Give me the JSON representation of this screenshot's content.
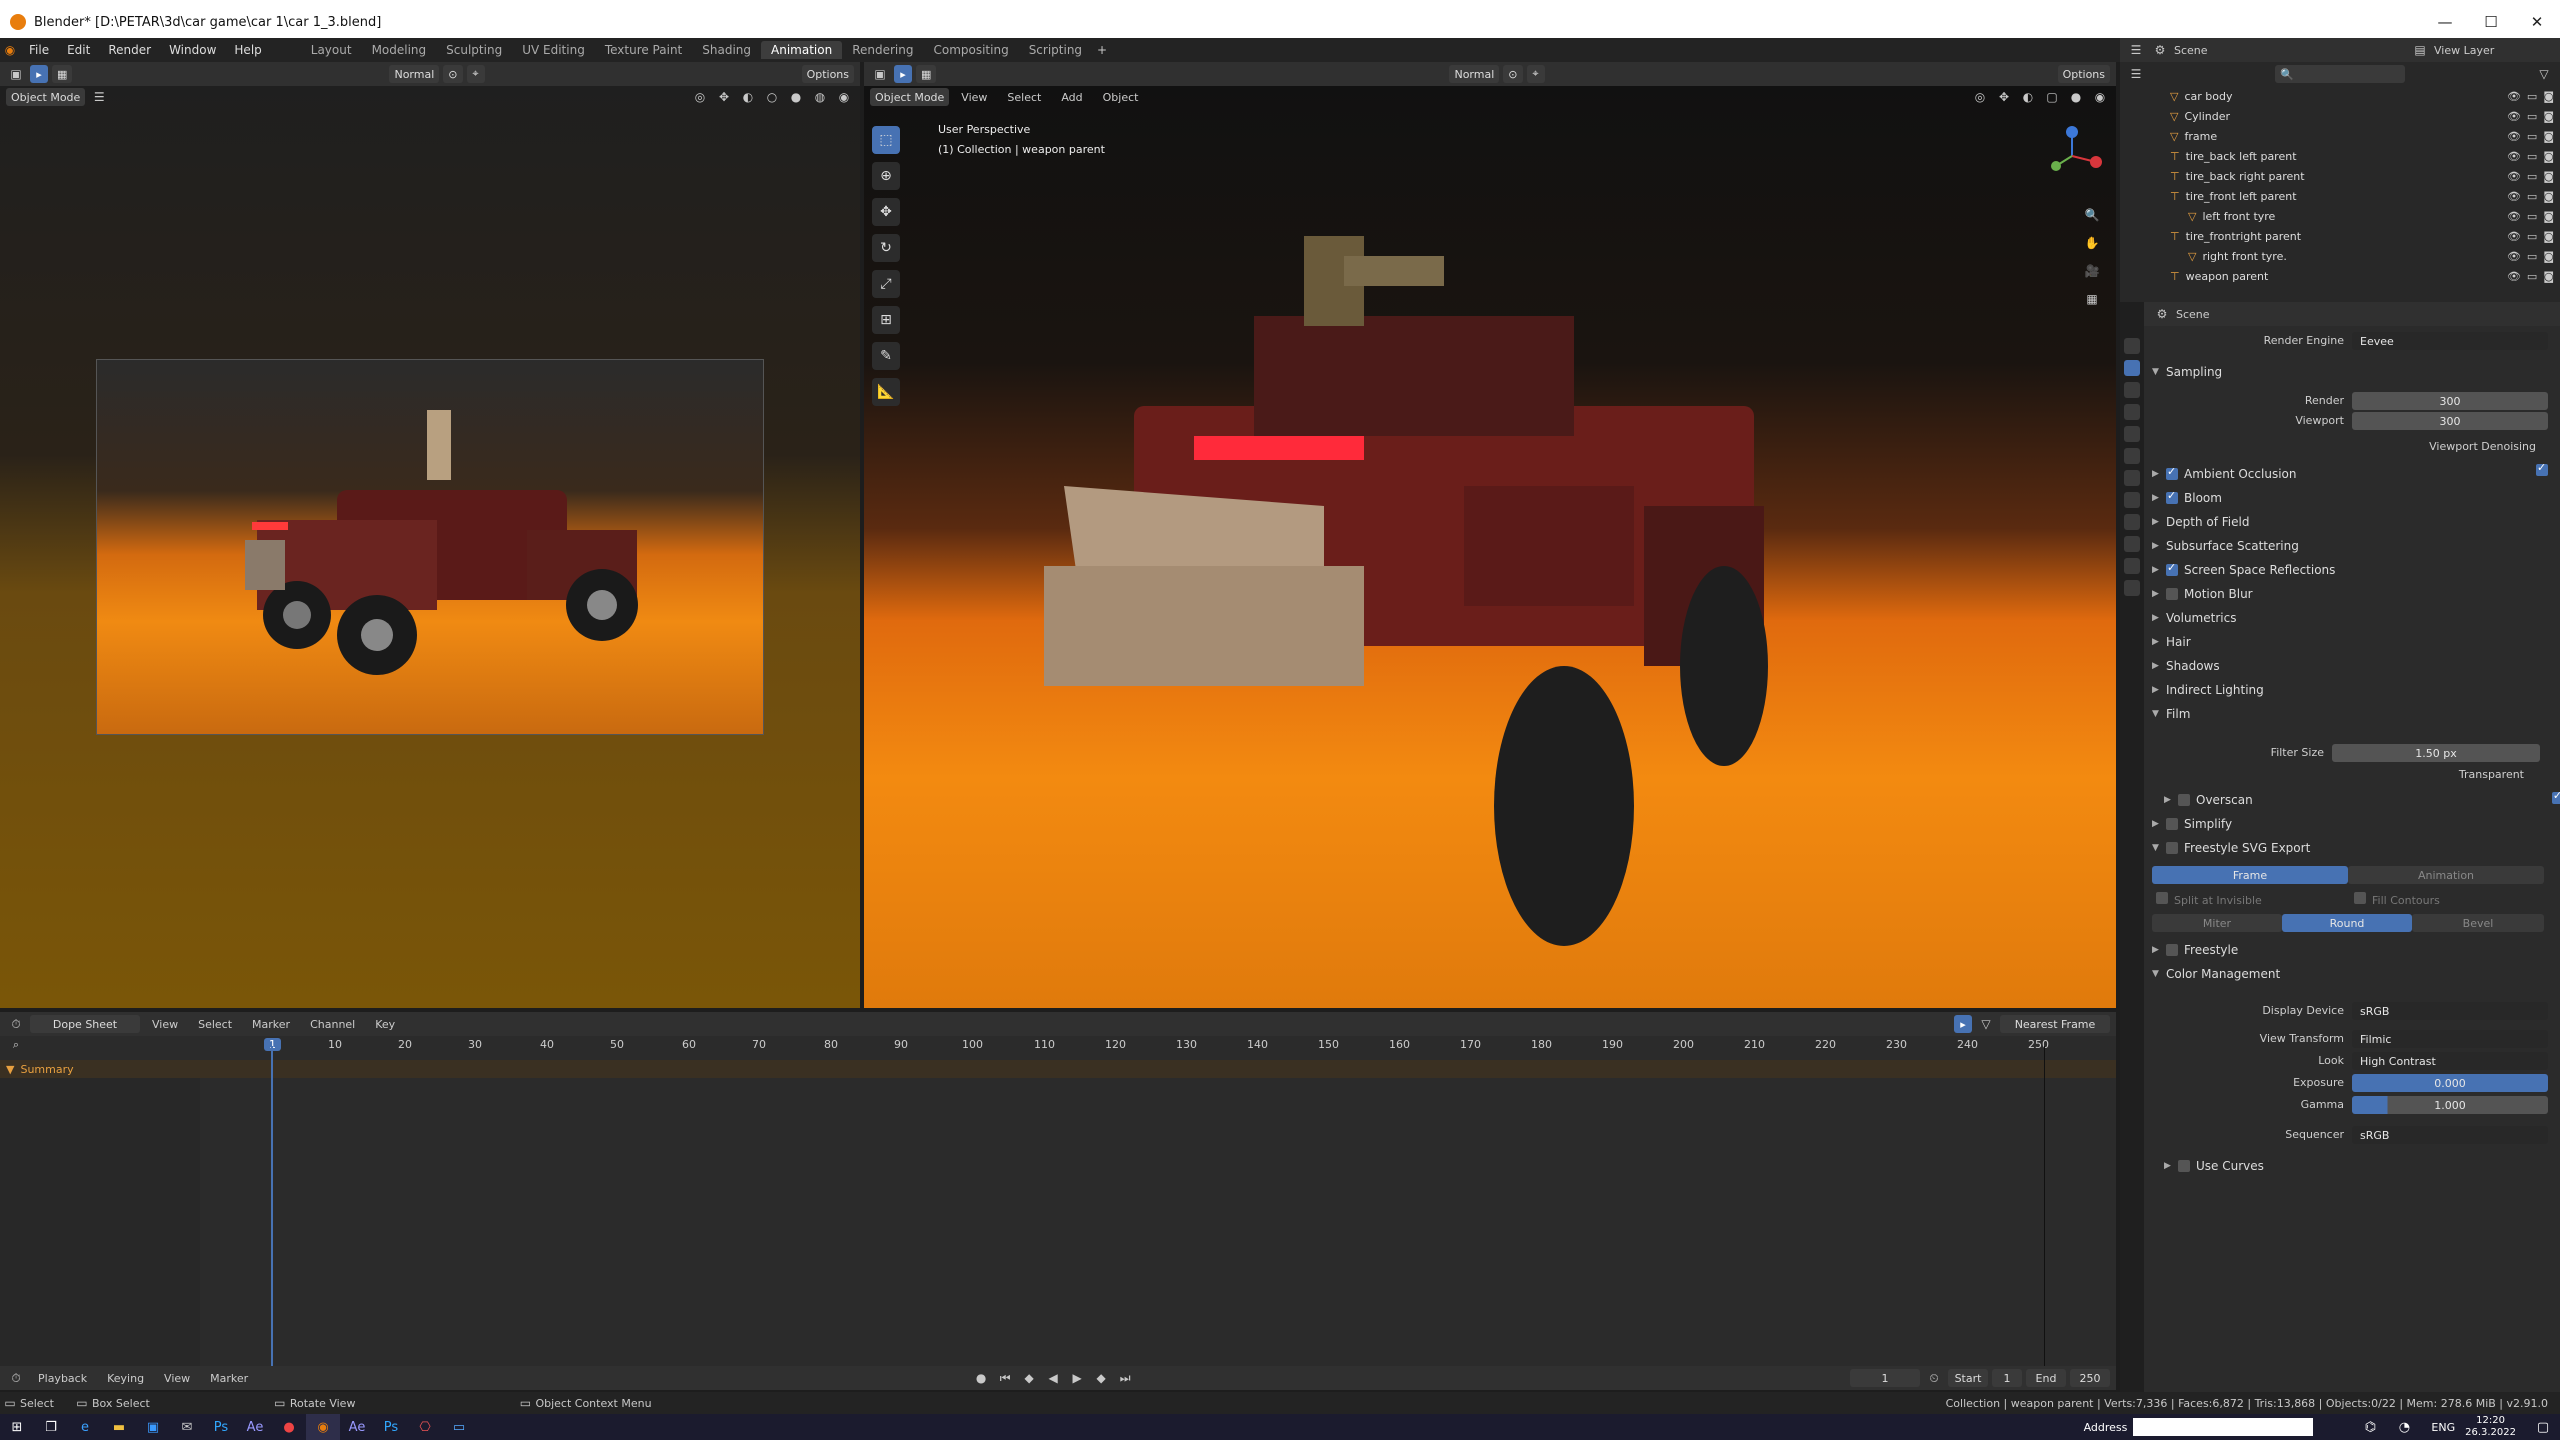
{
  "window": {
    "title": "Blender* [D:\\PETAR\\3d\\car game\\car 1\\car 1_3.blend]"
  },
  "menu": {
    "items": [
      "File",
      "Edit",
      "Render",
      "Window",
      "Help"
    ],
    "workspaces": [
      "Layout",
      "Modeling",
      "Sculpting",
      "UV Editing",
      "Texture Paint",
      "Shading",
      "Animation",
      "Rendering",
      "Compositing",
      "Scripting"
    ],
    "active_workspace": "Animation"
  },
  "left_view": {
    "orientation": "Normal",
    "options": "Options",
    "mode": "Object Mode"
  },
  "right_view": {
    "orientation": "Normal",
    "options": "Options",
    "mode": "Object Mode",
    "menu": [
      "View",
      "Select",
      "Add",
      "Object"
    ],
    "overlay_line1": "User Perspective",
    "overlay_line2": "(1) Collection | weapon parent"
  },
  "outliner": {
    "scene": "Scene",
    "view_layer": "View Layer",
    "items": [
      {
        "label": "car body"
      },
      {
        "label": "Cylinder"
      },
      {
        "label": "frame"
      },
      {
        "label": "tire_back left parent"
      },
      {
        "label": "tire_back right parent"
      },
      {
        "label": "tire_front left parent"
      },
      {
        "label": "left front tyre"
      },
      {
        "label": "tire_frontright parent"
      },
      {
        "label": "right front tyre."
      },
      {
        "label": "weapon parent"
      }
    ]
  },
  "properties": {
    "breadcrumb": "Scene",
    "render_engine_label": "Render Engine",
    "render_engine": "Eevee",
    "sampling": "Sampling",
    "render_label": "Render",
    "render_val": "300",
    "viewport_label": "Viewport",
    "viewport_val": "300",
    "viewport_denoising": "Viewport Denoising",
    "sections": {
      "ao": "Ambient Occlusion",
      "bloom": "Bloom",
      "dof": "Depth of Field",
      "sss": "Subsurface Scattering",
      "ssr": "Screen Space Reflections",
      "motion_blur": "Motion Blur",
      "volumetrics": "Volumetrics",
      "hair": "Hair",
      "shadows": "Shadows",
      "indirect": "Indirect Lighting",
      "film": "Film",
      "simplify": "Simplify",
      "freestyle_svg": "Freestyle SVG Export",
      "freestyle": "Freestyle",
      "color_mgmt": "Color Management"
    },
    "filter_size_label": "Filter Size",
    "filter_size": "1.50 px",
    "transparent": "Transparent",
    "overscan": "Overscan",
    "svg_frame": "Frame",
    "svg_animation": "Animation",
    "split_invisible": "Split at Invisible",
    "fill_contours": "Fill Contours",
    "miter": "Miter",
    "round": "Round",
    "bevel": "Bevel",
    "display_device_label": "Display Device",
    "display_device": "sRGB",
    "view_transform_label": "View Transform",
    "view_transform": "Filmic",
    "look_label": "Look",
    "look": "High Contrast",
    "exposure_label": "Exposure",
    "exposure": "0.000",
    "gamma_label": "Gamma",
    "gamma": "1.000",
    "sequencer_label": "Sequencer",
    "sequencer": "sRGB",
    "use_curves": "Use Curves"
  },
  "dopesheet": {
    "mode": "Dope Sheet",
    "menu": [
      "View",
      "Select",
      "Marker",
      "Channel",
      "Key"
    ],
    "snap": "Nearest Frame",
    "summary": "Summary",
    "current_frame": "1",
    "ticks": [
      "10",
      "20",
      "30",
      "40",
      "50",
      "60",
      "70",
      "80",
      "90",
      "100",
      "110",
      "120",
      "130",
      "140",
      "150",
      "160",
      "170",
      "180",
      "190",
      "200",
      "210",
      "220",
      "230",
      "240",
      "250"
    ]
  },
  "timeline": {
    "menu": [
      "Playback",
      "Keying",
      "View",
      "Marker"
    ],
    "frame": "1",
    "start_label": "Start",
    "start": "1",
    "end_label": "End",
    "end": "250"
  },
  "status": {
    "select": "Select",
    "box_select": "Box Select",
    "rotate": "Rotate View",
    "context": "Object Context Menu",
    "stats": "Collection | weapon parent | Verts:7,336 | Faces:6,872 | Tris:13,868 | Objects:0/22 | Mem: 278.6 MiB | v2.91.0"
  },
  "taskbar": {
    "address": "Address",
    "lang": "ENG",
    "time": "12:20",
    "date": "26.3.2022"
  }
}
